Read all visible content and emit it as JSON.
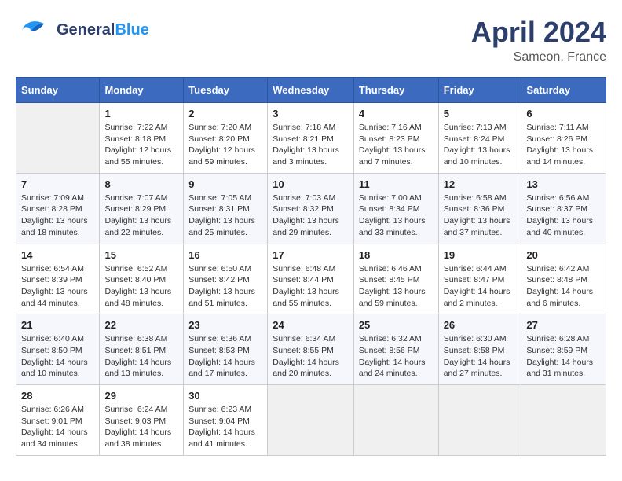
{
  "header": {
    "logo": {
      "line1": "General",
      "line2": "Blue"
    },
    "title": "April 2024",
    "location": "Sameon, France"
  },
  "weekdays": [
    "Sunday",
    "Monday",
    "Tuesday",
    "Wednesday",
    "Thursday",
    "Friday",
    "Saturday"
  ],
  "weeks": [
    [
      {
        "day": null,
        "info": null
      },
      {
        "day": "1",
        "sunrise": "7:22 AM",
        "sunset": "8:18 PM",
        "daylight": "12 hours and 55 minutes."
      },
      {
        "day": "2",
        "sunrise": "7:20 AM",
        "sunset": "8:20 PM",
        "daylight": "12 hours and 59 minutes."
      },
      {
        "day": "3",
        "sunrise": "7:18 AM",
        "sunset": "8:21 PM",
        "daylight": "13 hours and 3 minutes."
      },
      {
        "day": "4",
        "sunrise": "7:16 AM",
        "sunset": "8:23 PM",
        "daylight": "13 hours and 7 minutes."
      },
      {
        "day": "5",
        "sunrise": "7:13 AM",
        "sunset": "8:24 PM",
        "daylight": "13 hours and 10 minutes."
      },
      {
        "day": "6",
        "sunrise": "7:11 AM",
        "sunset": "8:26 PM",
        "daylight": "13 hours and 14 minutes."
      }
    ],
    [
      {
        "day": "7",
        "sunrise": "7:09 AM",
        "sunset": "8:28 PM",
        "daylight": "13 hours and 18 minutes."
      },
      {
        "day": "8",
        "sunrise": "7:07 AM",
        "sunset": "8:29 PM",
        "daylight": "13 hours and 22 minutes."
      },
      {
        "day": "9",
        "sunrise": "7:05 AM",
        "sunset": "8:31 PM",
        "daylight": "13 hours and 25 minutes."
      },
      {
        "day": "10",
        "sunrise": "7:03 AM",
        "sunset": "8:32 PM",
        "daylight": "13 hours and 29 minutes."
      },
      {
        "day": "11",
        "sunrise": "7:00 AM",
        "sunset": "8:34 PM",
        "daylight": "13 hours and 33 minutes."
      },
      {
        "day": "12",
        "sunrise": "6:58 AM",
        "sunset": "8:36 PM",
        "daylight": "13 hours and 37 minutes."
      },
      {
        "day": "13",
        "sunrise": "6:56 AM",
        "sunset": "8:37 PM",
        "daylight": "13 hours and 40 minutes."
      }
    ],
    [
      {
        "day": "14",
        "sunrise": "6:54 AM",
        "sunset": "8:39 PM",
        "daylight": "13 hours and 44 minutes."
      },
      {
        "day": "15",
        "sunrise": "6:52 AM",
        "sunset": "8:40 PM",
        "daylight": "13 hours and 48 minutes."
      },
      {
        "day": "16",
        "sunrise": "6:50 AM",
        "sunset": "8:42 PM",
        "daylight": "13 hours and 51 minutes."
      },
      {
        "day": "17",
        "sunrise": "6:48 AM",
        "sunset": "8:44 PM",
        "daylight": "13 hours and 55 minutes."
      },
      {
        "day": "18",
        "sunrise": "6:46 AM",
        "sunset": "8:45 PM",
        "daylight": "13 hours and 59 minutes."
      },
      {
        "day": "19",
        "sunrise": "6:44 AM",
        "sunset": "8:47 PM",
        "daylight": "14 hours and 2 minutes."
      },
      {
        "day": "20",
        "sunrise": "6:42 AM",
        "sunset": "8:48 PM",
        "daylight": "14 hours and 6 minutes."
      }
    ],
    [
      {
        "day": "21",
        "sunrise": "6:40 AM",
        "sunset": "8:50 PM",
        "daylight": "14 hours and 10 minutes."
      },
      {
        "day": "22",
        "sunrise": "6:38 AM",
        "sunset": "8:51 PM",
        "daylight": "14 hours and 13 minutes."
      },
      {
        "day": "23",
        "sunrise": "6:36 AM",
        "sunset": "8:53 PM",
        "daylight": "14 hours and 17 minutes."
      },
      {
        "day": "24",
        "sunrise": "6:34 AM",
        "sunset": "8:55 PM",
        "daylight": "14 hours and 20 minutes."
      },
      {
        "day": "25",
        "sunrise": "6:32 AM",
        "sunset": "8:56 PM",
        "daylight": "14 hours and 24 minutes."
      },
      {
        "day": "26",
        "sunrise": "6:30 AM",
        "sunset": "8:58 PM",
        "daylight": "14 hours and 27 minutes."
      },
      {
        "day": "27",
        "sunrise": "6:28 AM",
        "sunset": "8:59 PM",
        "daylight": "14 hours and 31 minutes."
      }
    ],
    [
      {
        "day": "28",
        "sunrise": "6:26 AM",
        "sunset": "9:01 PM",
        "daylight": "14 hours and 34 minutes."
      },
      {
        "day": "29",
        "sunrise": "6:24 AM",
        "sunset": "9:03 PM",
        "daylight": "14 hours and 38 minutes."
      },
      {
        "day": "30",
        "sunrise": "6:23 AM",
        "sunset": "9:04 PM",
        "daylight": "14 hours and 41 minutes."
      },
      {
        "day": null,
        "info": null
      },
      {
        "day": null,
        "info": null
      },
      {
        "day": null,
        "info": null
      },
      {
        "day": null,
        "info": null
      }
    ]
  ]
}
